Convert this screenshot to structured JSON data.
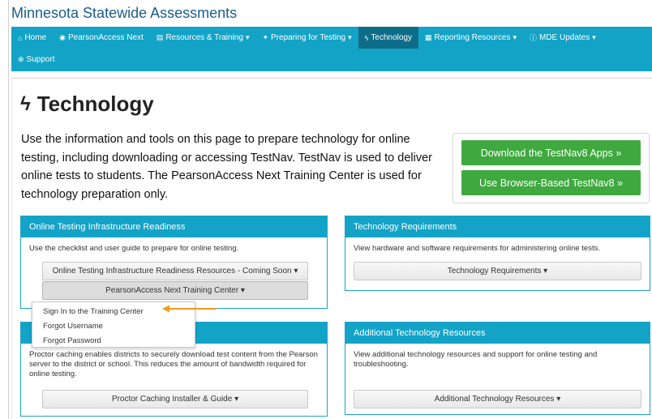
{
  "site": {
    "title": "Minnesota Statewide Assessments"
  },
  "nav": {
    "items": [
      {
        "label": "Home",
        "icon": "home-icon",
        "glyph": "⌂",
        "has_caret": false,
        "active": false
      },
      {
        "label": "PearsonAccess Next",
        "icon": "globe-icon",
        "glyph": "◉",
        "has_caret": false,
        "active": false
      },
      {
        "label": "Resources & Training",
        "icon": "book-icon",
        "glyph": "▤",
        "has_caret": true,
        "active": false
      },
      {
        "label": "Preparing for Testing",
        "icon": "people-icon",
        "glyph": "✦",
        "has_caret": true,
        "active": false
      },
      {
        "label": "Technology",
        "icon": "bolt-icon",
        "glyph": "ϟ",
        "has_caret": false,
        "active": true
      },
      {
        "label": "Reporting Resources",
        "icon": "chart-icon",
        "glyph": "▦",
        "has_caret": true,
        "active": false
      },
      {
        "label": "MDE Updates",
        "icon": "info-icon",
        "glyph": "ⓘ",
        "has_caret": true,
        "active": false
      },
      {
        "label": "Support",
        "icon": "support-icon",
        "glyph": "⊕",
        "has_caret": false,
        "active": false
      }
    ]
  },
  "page": {
    "title": "Technology",
    "intro": "Use the information and tools on this page to prepare technology for online testing, including downloading or accessing TestNav. TestNav is used to deliver online tests to students. The PearsonAccess Next Training Center is used for technology preparation only."
  },
  "downloads": {
    "apps_button": "Download the TestNav8 Apps »",
    "browser_button": "Use Browser-Based TestNav8 »"
  },
  "panels": {
    "infrastructure": {
      "title": "Online Testing Infrastructure Readiness",
      "body": "Use the checklist and user guide to prepare for online testing.",
      "button1": "Online Testing Infrastructure Readiness Resources - Coming Soon ▾",
      "button2": "PearsonAccess Next Training Center ▾"
    },
    "requirements": {
      "title": "Technology Requirements",
      "body": "View hardware and software requirements for administering online tests.",
      "button": "Technology Requirements ▾"
    },
    "proctor": {
      "body": "Proctor caching enables districts to securely download test content from the Pearson server to the district or school. This reduces the amount of bandwidth required for online testing.",
      "button": "Proctor Caching Installer & Guide ▾"
    },
    "additional": {
      "title": "Additional Technology Resources",
      "body": "View additional technology resources and support for online testing and troubleshooting.",
      "button": "Additional Technology Resources ▾"
    }
  },
  "dropdown": {
    "items": [
      "Sign In to the Training Center",
      "Forgot Username",
      "Forgot Password"
    ]
  },
  "colors": {
    "nav_bg": "#13a3c7",
    "nav_active": "#0d6d88",
    "green": "#3fa83f",
    "arrow": "#f39a1e",
    "title": "#1a5d8a"
  }
}
